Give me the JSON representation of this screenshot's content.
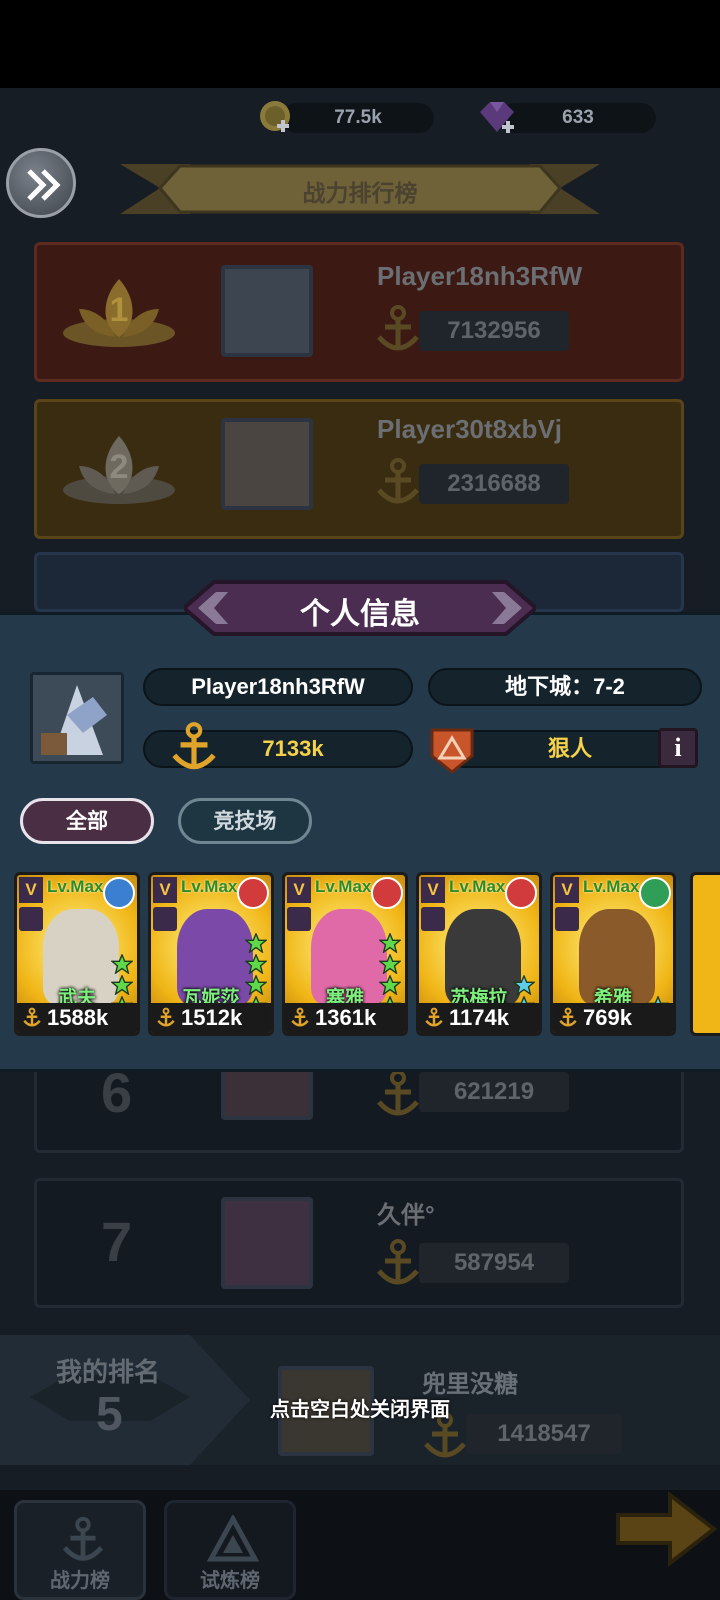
{
  "currency": {
    "gold": "77.5k",
    "gems": "633"
  },
  "leaderboard": {
    "title": "战力排行榜",
    "rows": [
      {
        "rank": "1",
        "name": "Player18nh3RfW",
        "power": "7132956"
      },
      {
        "rank": "2",
        "name": "Player30t8xbVj",
        "power": "2316688"
      },
      {
        "rank": "6",
        "name": "",
        "power": "621219"
      },
      {
        "rank": "7",
        "name": "久伴°",
        "power": "587954"
      }
    ],
    "my_rank": {
      "label": "我的排名",
      "rank": "5",
      "name": "兜里没糖",
      "power": "1418547"
    }
  },
  "profile": {
    "title": "个人信息",
    "player_name": "Player18nh3RfW",
    "dungeon": "地下城：7-2",
    "power": "7133k",
    "guild": "狠人",
    "tabs": {
      "all": "全部",
      "arena": "竞技场"
    },
    "heroes": [
      {
        "name": "武夫",
        "power": "1588k",
        "level": "Lv.Max",
        "stars": 3,
        "element": "water",
        "element_color": "#3b7fd1"
      },
      {
        "name": "瓦妮莎",
        "power": "1512k",
        "level": "Lv.Max",
        "stars": 4,
        "element": "fire",
        "element_color": "#d13b3b"
      },
      {
        "name": "塞雅",
        "power": "1361k",
        "level": "Lv.Max",
        "stars": 4,
        "element": "fire",
        "element_color": "#d13b3b"
      },
      {
        "name": "苏梅拉",
        "power": "1174k",
        "level": "Lv.Max",
        "stars": 2,
        "element": "fire",
        "element_color": "#d13b3b"
      },
      {
        "name": "希雅",
        "power": "769k",
        "level": "Lv.Max",
        "stars": 1,
        "element": "wind",
        "element_color": "#2f9e57"
      }
    ]
  },
  "hint": "点击空白处关闭界面",
  "nav": {
    "power_rank": "战力榜",
    "trial_rank": "试炼榜"
  }
}
